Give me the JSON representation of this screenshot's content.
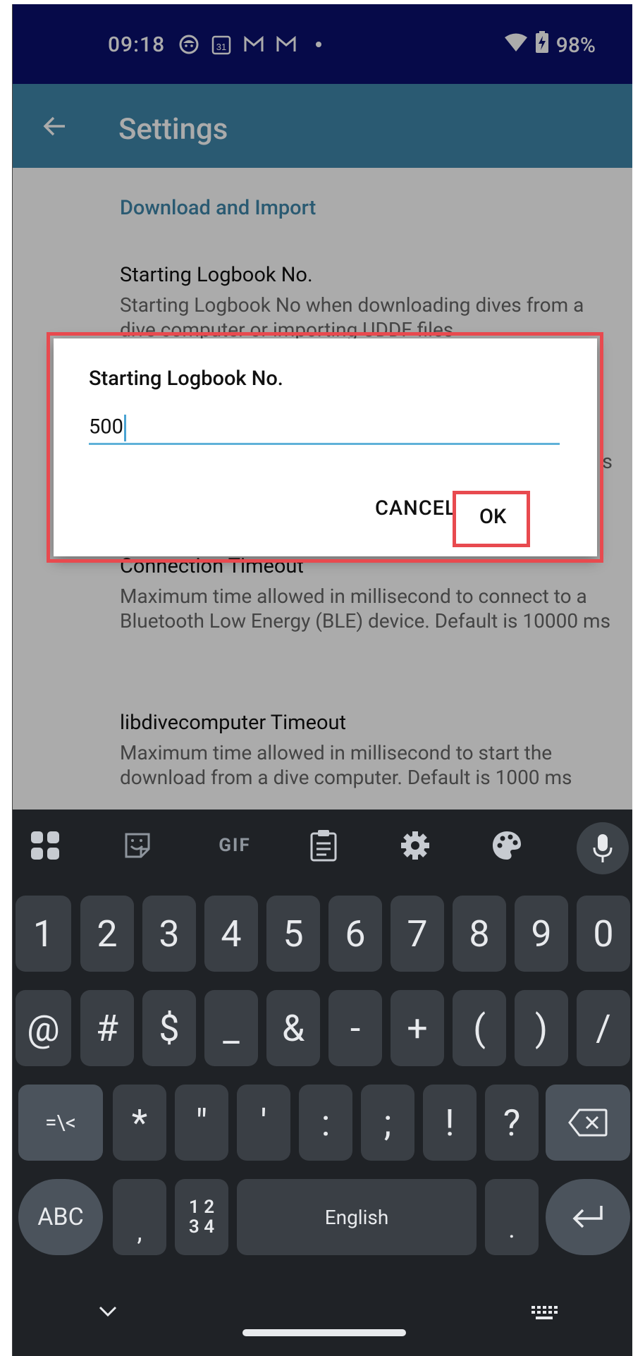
{
  "status_bar": {
    "time": "09:18",
    "calendar_day": "31",
    "battery": "98%",
    "notification_icons": [
      "face-icon",
      "calendar-icon",
      "gmail-icon",
      "gmail-icon",
      "dot-icon"
    ],
    "right_icons": [
      "wifi-icon",
      "battery-charging-icon"
    ]
  },
  "app_bar": {
    "title": "Settings",
    "back_icon": "arrow-left-icon",
    "color": "#3f87aa"
  },
  "content": {
    "section_title": "Download and Import",
    "prefs": [
      {
        "title": "Starting Logbook No.",
        "summary": "Starting Logbook No when downloading dives from a dive computer or importing UDDF files"
      },
      {
        "title": "Connection Timeout",
        "summary": "Maximum time allowed in millisecond to connect to a Bluetooth Low Energy (BLE) device. Default is 10000 ms"
      },
      {
        "title": "libdivecomputer Timeout",
        "summary": "Maximum time allowed in millisecond to start the download from a dive computer. Default is 1000 ms"
      }
    ],
    "hidden_fragment": "s"
  },
  "dialog": {
    "title": "Starting Logbook No.",
    "value": "500",
    "cancel_label": "CANCEL",
    "ok_label": "OK",
    "highlight_color": "#e84a4f"
  },
  "keyboard": {
    "toolbar_icons": [
      "apps-grid-icon",
      "sticker-icon",
      "gif-icon",
      "clipboard-icon",
      "settings-gear-icon",
      "palette-icon",
      "microphone-icon"
    ],
    "gif_label": "GIF",
    "row1": [
      "1",
      "2",
      "3",
      "4",
      "5",
      "6",
      "7",
      "8",
      "9",
      "0"
    ],
    "row2": [
      "@",
      "#",
      "$",
      "_",
      "&",
      "-",
      "+",
      "(",
      ")",
      "/"
    ],
    "row3": [
      "=\\<",
      "*",
      "\"",
      "'",
      ":",
      ";",
      "!",
      "?"
    ],
    "row4": {
      "abc": "ABC",
      "comma": ",",
      "numpad_top": "1 2",
      "numpad_bottom": "3 4",
      "space": "English",
      "period": "."
    },
    "backspace_icon": "backspace-icon",
    "enter_icon": "enter-icon"
  },
  "nav_bar": {
    "icons": [
      "chevron-down-icon",
      "keyboard-icon"
    ]
  }
}
